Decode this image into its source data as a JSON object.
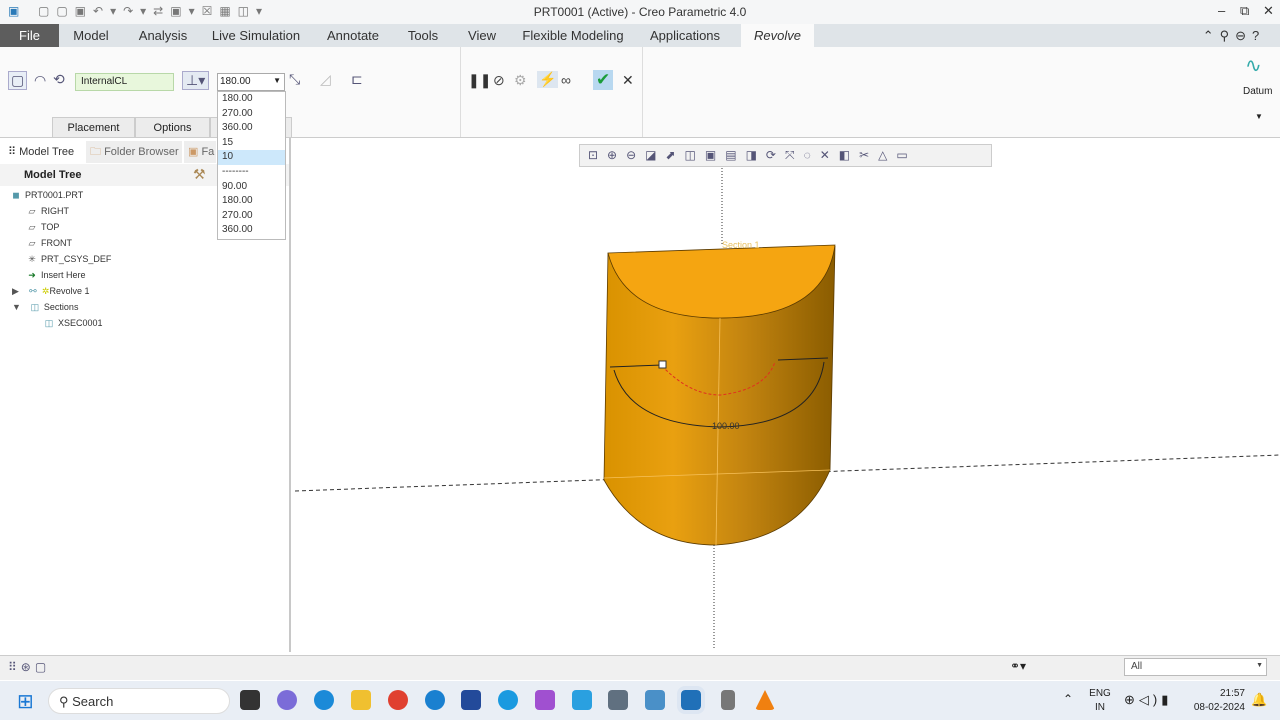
{
  "window": {
    "title": "PRT0001 (Active) - Creo Parametric 4.0"
  },
  "tabs": [
    "File",
    "Model",
    "Analysis",
    "Live Simulation",
    "Annotate",
    "Tools",
    "View",
    "Flexible Modeling",
    "Applications",
    "Revolve"
  ],
  "ribbon": {
    "axis_field": "InternalCL",
    "angle_value": "180.00",
    "datum_label": "Datum",
    "subtabs": [
      "Placement",
      "Options"
    ]
  },
  "angle_dropdown": {
    "options": [
      "180.00",
      "270.00",
      "360.00",
      "15",
      "10",
      "--------",
      "90.00",
      "180.00",
      "270.00",
      "360.00"
    ],
    "selected_index": 4
  },
  "left_panel": {
    "tabs": [
      "Model Tree",
      "Folder Browser",
      "Fa"
    ],
    "header": "Model Tree",
    "items": [
      {
        "label": "PRT0001.PRT",
        "icon": "part-icon"
      },
      {
        "label": "RIGHT",
        "icon": "datum-plane-icon"
      },
      {
        "label": "TOP",
        "icon": "datum-plane-icon"
      },
      {
        "label": "FRONT",
        "icon": "datum-plane-icon"
      },
      {
        "label": "PRT_CSYS_DEF",
        "icon": "csys-icon"
      },
      {
        "label": "Insert Here",
        "icon": "insert-arrow-icon"
      },
      {
        "label": "Revolve 1",
        "icon": "revolve-icon"
      },
      {
        "label": "Sections",
        "icon": "sections-icon"
      },
      {
        "label": "XSEC0001",
        "icon": "xsec-icon"
      }
    ]
  },
  "viewport": {
    "section_label": "Section 1",
    "dimension": "100.00",
    "model_color": "#f2a512"
  },
  "status_bar": {
    "filter": "All"
  },
  "taskbar": {
    "search": "Search",
    "lang": "ENG",
    "region": "IN",
    "time": "21:57",
    "date": "08-02-2024"
  }
}
